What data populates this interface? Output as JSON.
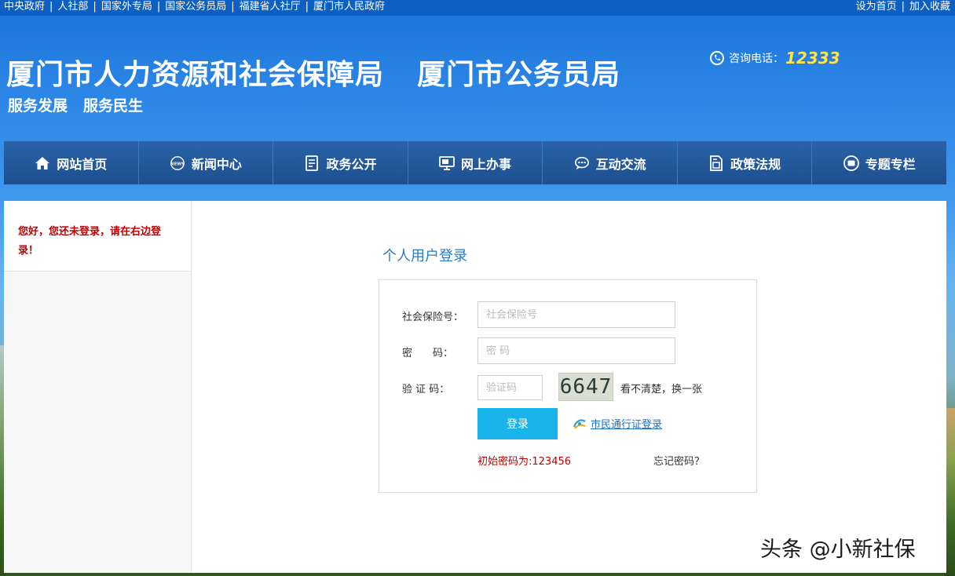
{
  "topbar": {
    "links": [
      "中央政府",
      "人社部",
      "国家外专局",
      "国家公务员局",
      "福建省人社厅",
      "厦门市人民政府"
    ],
    "right_links": [
      "设为首页",
      "加入收藏"
    ],
    "separator": "|"
  },
  "header": {
    "title_main": "厦门市人力资源和社会保障局",
    "title_secondary": "厦门市公务员局",
    "slogan_1": "服务发展",
    "slogan_2": "服务民生",
    "hotline_label": "咨询电话：",
    "hotline_number": "12333"
  },
  "nav": {
    "items": [
      {
        "label": "网站首页",
        "icon": "home-icon"
      },
      {
        "label": "新闻中心",
        "icon": "news-icon"
      },
      {
        "label": "政务公开",
        "icon": "document-icon"
      },
      {
        "label": "网上办事",
        "icon": "monitor-icon"
      },
      {
        "label": "互动交流",
        "icon": "chat-icon"
      },
      {
        "label": "政策法规",
        "icon": "policy-icon"
      },
      {
        "label": "专题专栏",
        "icon": "topic-icon"
      }
    ]
  },
  "sidebar": {
    "notice": "您好，您还未登录，请在右边登录！"
  },
  "login": {
    "title": "个人用户登录",
    "ssn_label": "社会保险号：",
    "ssn_placeholder": "社会保险号",
    "password_label": "密　　码：",
    "password_placeholder": "密 码",
    "captcha_label": "验 证 码：",
    "captcha_placeholder": "验证码",
    "captcha_value": "6647",
    "refresh_text": "看不清楚，换一张",
    "login_button": "登录",
    "citizen_login": "市民通行证登录",
    "initial_password": "初始密码为:123456",
    "forgot_password": "忘记密码？"
  },
  "watermark": "头条 @小新社保",
  "colors": {
    "header_blue": "#1a73d9",
    "nav_blue": "#2a63a8",
    "accent_yellow": "#ffe44d",
    "login_button": "#1ab3ea",
    "notice_red": "#c00000",
    "title_blue": "#2a7ac0"
  }
}
